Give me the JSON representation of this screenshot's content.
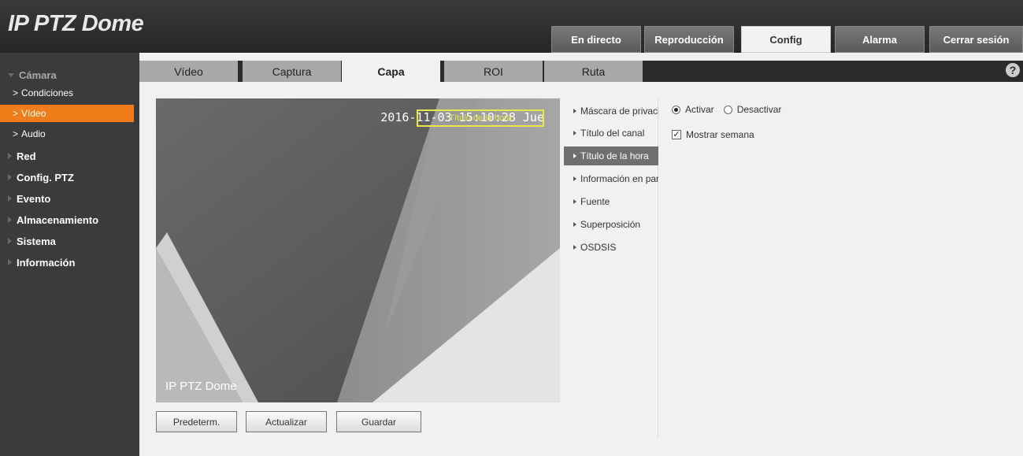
{
  "app": {
    "title": "IP PTZ Dome"
  },
  "nav": {
    "tabs": [
      {
        "label": "En directo",
        "active": false
      },
      {
        "label": "Reproducción",
        "active": false
      },
      {
        "label": "Config",
        "active": true
      },
      {
        "label": "Alarma",
        "active": false
      },
      {
        "label": "Cerrar sesión",
        "active": false
      }
    ]
  },
  "sidebar": {
    "items": [
      {
        "label": "Cámara",
        "expanded": true
      },
      {
        "label": "Condiciones",
        "sub": true
      },
      {
        "label": "Vídeo",
        "sub": true,
        "active": true
      },
      {
        "label": "Audio",
        "sub": true
      },
      {
        "label": "Red"
      },
      {
        "label": "Config. PTZ"
      },
      {
        "label": "Evento"
      },
      {
        "label": "Almacenamiento"
      },
      {
        "label": "Sistema"
      },
      {
        "label": "Información"
      }
    ]
  },
  "subtabs": [
    {
      "label": "Vídeo",
      "active": false
    },
    {
      "label": "Captura",
      "active": false
    },
    {
      "label": "Capa",
      "active": true
    },
    {
      "label": "ROI",
      "active": false
    },
    {
      "label": "Ruta",
      "active": false
    }
  ],
  "help": {
    "icon": "?"
  },
  "video": {
    "time_overlay": "2016-11-03 15:10:28 Jue",
    "title_box": "Título de la hora",
    "channel_overlay": "IP PTZ Dome"
  },
  "buttons": {
    "default": "Predeterm.",
    "refresh": "Actualizar",
    "save": "Guardar"
  },
  "osd_menu": [
    {
      "label": "Máscara de privacidad",
      "active": false
    },
    {
      "label": "Título del canal",
      "active": false
    },
    {
      "label": "Título de la hora",
      "active": true
    },
    {
      "label": "Información en pantalla",
      "active": false
    },
    {
      "label": "Fuente",
      "active": false
    },
    {
      "label": "Superposición",
      "active": false
    },
    {
      "label": "OSDSIS",
      "active": false
    }
  ],
  "options": {
    "enable": "Activar",
    "disable": "Desactivar",
    "enable_selected": true,
    "show_week": "Mostrar semana",
    "show_week_checked": true
  },
  "colors": {
    "accent": "#f07c1a",
    "header": "#2b2b2b",
    "active_menu": "#6f6f6f",
    "osd_box": "#e8e84a"
  }
}
